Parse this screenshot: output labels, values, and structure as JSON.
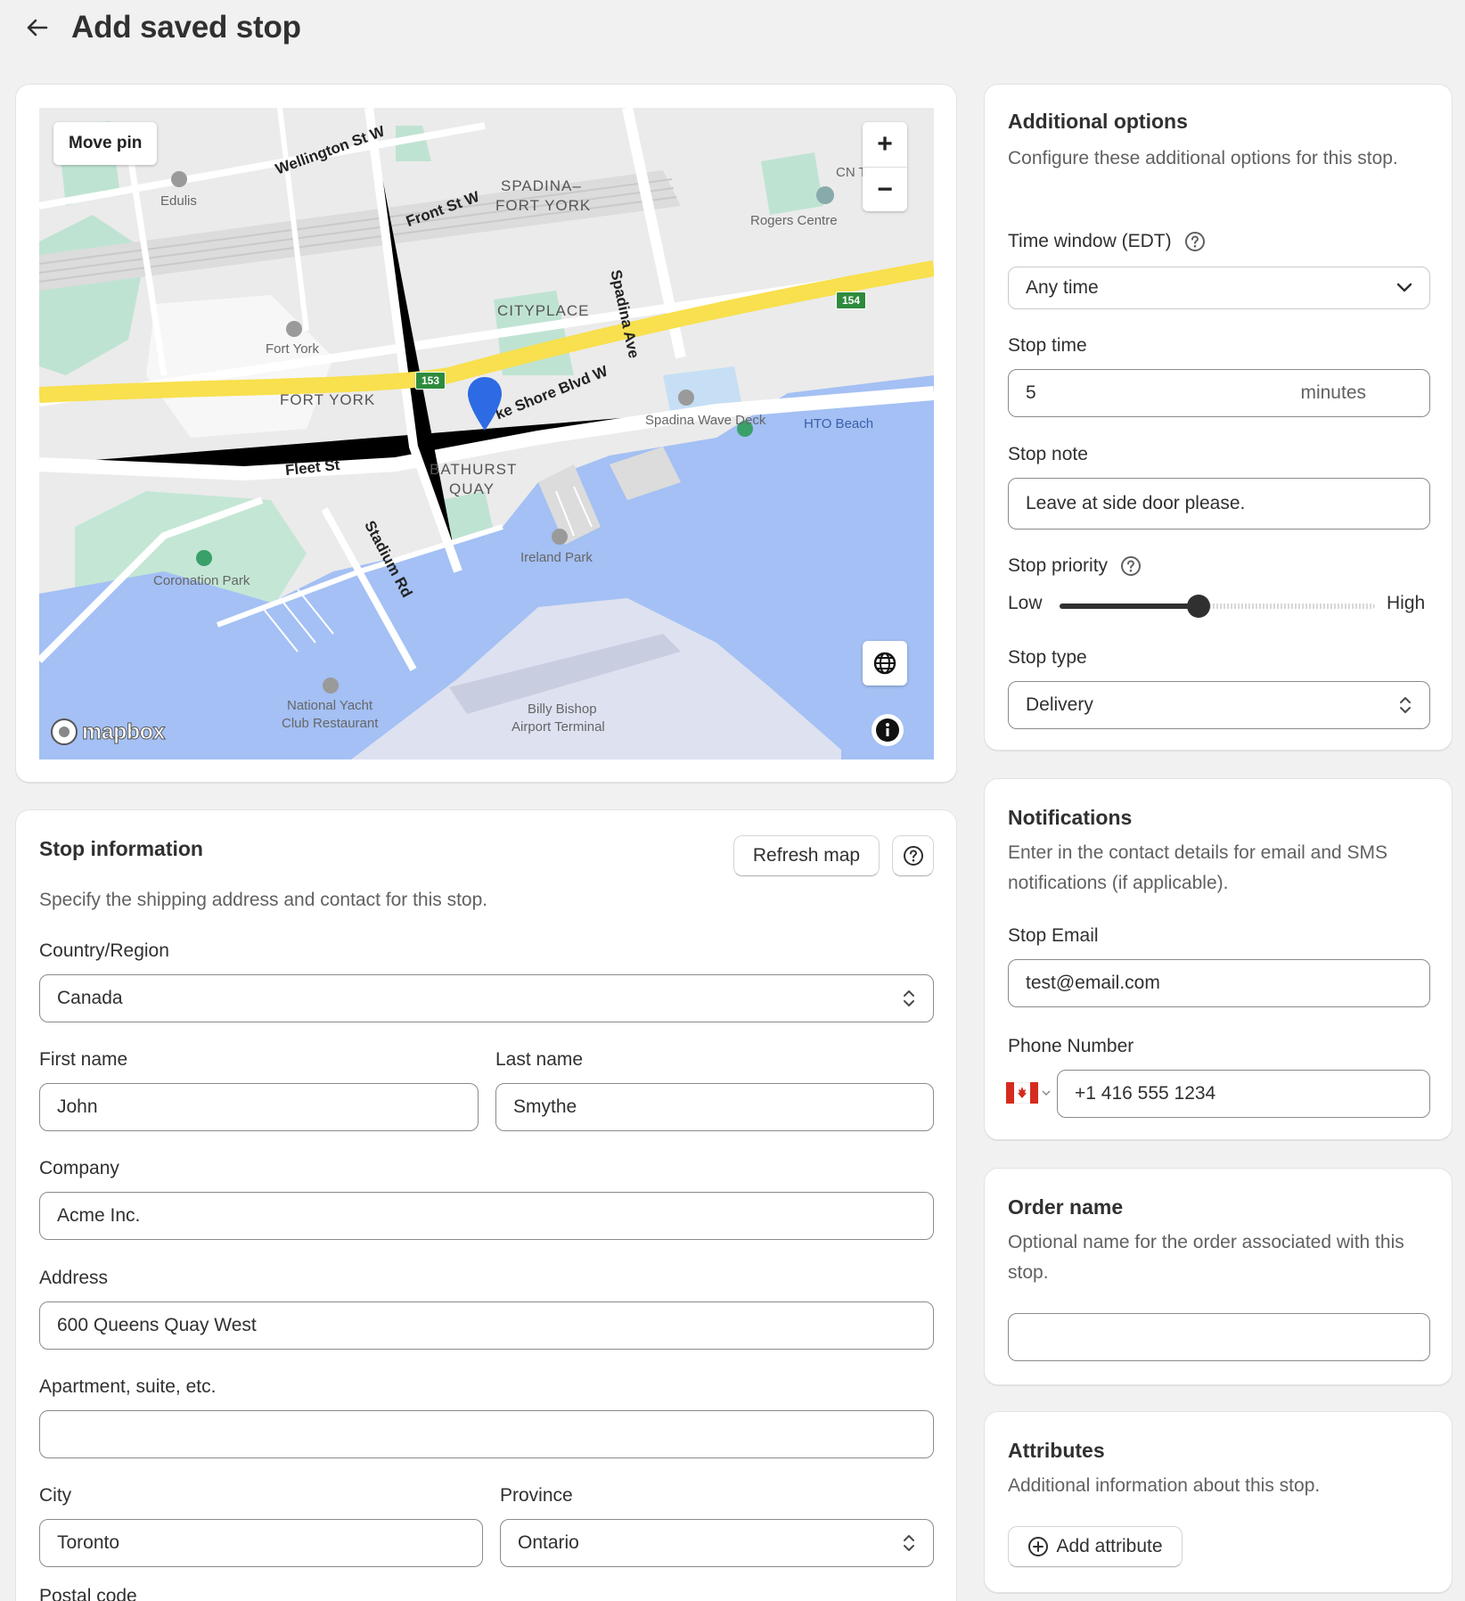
{
  "header": {
    "title": "Add saved stop"
  },
  "map": {
    "move_pin_label": "Move pin",
    "zoom_in": "+",
    "zoom_out": "−",
    "attribution": "mapbox",
    "labels": {
      "wellington": "Wellington St W",
      "front": "Front St W",
      "spadina_fort_york_1": "SPADINA–",
      "spadina_fort_york_2": "FORT YORK",
      "spadina_ave": "Spadina Ave",
      "rogers": "Rogers Centre",
      "cn": "CN T",
      "edulis": "Edulis",
      "cityplace": "CITYPLACE",
      "fort_york_poi": "Fort York",
      "fort_york_area": "FORT YORK",
      "lakeshore": "ke Shore Blvd W",
      "spadina_wave": "Spadina Wave Deck",
      "hto": "HTO Beach",
      "fleet": "Fleet St",
      "bathurst_1": "BATHURST",
      "bathurst_2": "QUAY",
      "stadium": "Stadium Rd",
      "ireland": "Ireland Park",
      "coronation": "Coronation Park",
      "yacht_1": "National Yacht",
      "yacht_2": "Club Restaurant",
      "billy_1": "Billy Bishop",
      "billy_2": "Airport Terminal",
      "shield_153": "153",
      "shield_154": "154"
    }
  },
  "stop_info": {
    "title": "Stop information",
    "description": "Specify the shipping address and contact for this stop.",
    "refresh_label": "Refresh map",
    "country_label": "Country/Region",
    "country_value": "Canada",
    "first_name_label": "First name",
    "first_name_value": "John",
    "last_name_label": "Last name",
    "last_name_value": "Smythe",
    "company_label": "Company",
    "company_value": "Acme Inc.",
    "address_label": "Address",
    "address_value": "600 Queens Quay West",
    "apartment_label": "Apartment, suite, etc.",
    "apartment_value": "",
    "city_label": "City",
    "city_value": "Toronto",
    "province_label": "Province",
    "province_value": "Ontario",
    "postal_label": "Postal code"
  },
  "additional": {
    "title": "Additional options",
    "description": "Configure these additional options for this stop.",
    "time_window_label": "Time window (EDT)",
    "time_window_value": "Any time",
    "stop_time_label": "Stop time",
    "stop_time_value": "5",
    "stop_time_suffix": "minutes",
    "stop_note_label": "Stop note",
    "stop_note_value": "Leave at side door please.",
    "priority_label": "Stop priority",
    "priority_low": "Low",
    "priority_high": "High",
    "priority_level": 0.44,
    "stop_type_label": "Stop type",
    "stop_type_value": "Delivery"
  },
  "notifications": {
    "title": "Notifications",
    "description": "Enter in the contact details for email and SMS notifications (if applicable).",
    "email_label": "Stop Email",
    "email_value": "test@email.com",
    "phone_label": "Phone Number",
    "phone_value": "+1 416 555 1234"
  },
  "order": {
    "title": "Order name",
    "description": "Optional name for the order associated with this stop.",
    "value": ""
  },
  "attributes": {
    "title": "Attributes",
    "description": "Additional information about this stop.",
    "add_label": "Add attribute"
  },
  "colors": {
    "water": "#a4c0f4",
    "highway": "#f8e04e",
    "park": "#bfe3d2",
    "pin": "#2d6be4",
    "slider_active": "#303030"
  }
}
